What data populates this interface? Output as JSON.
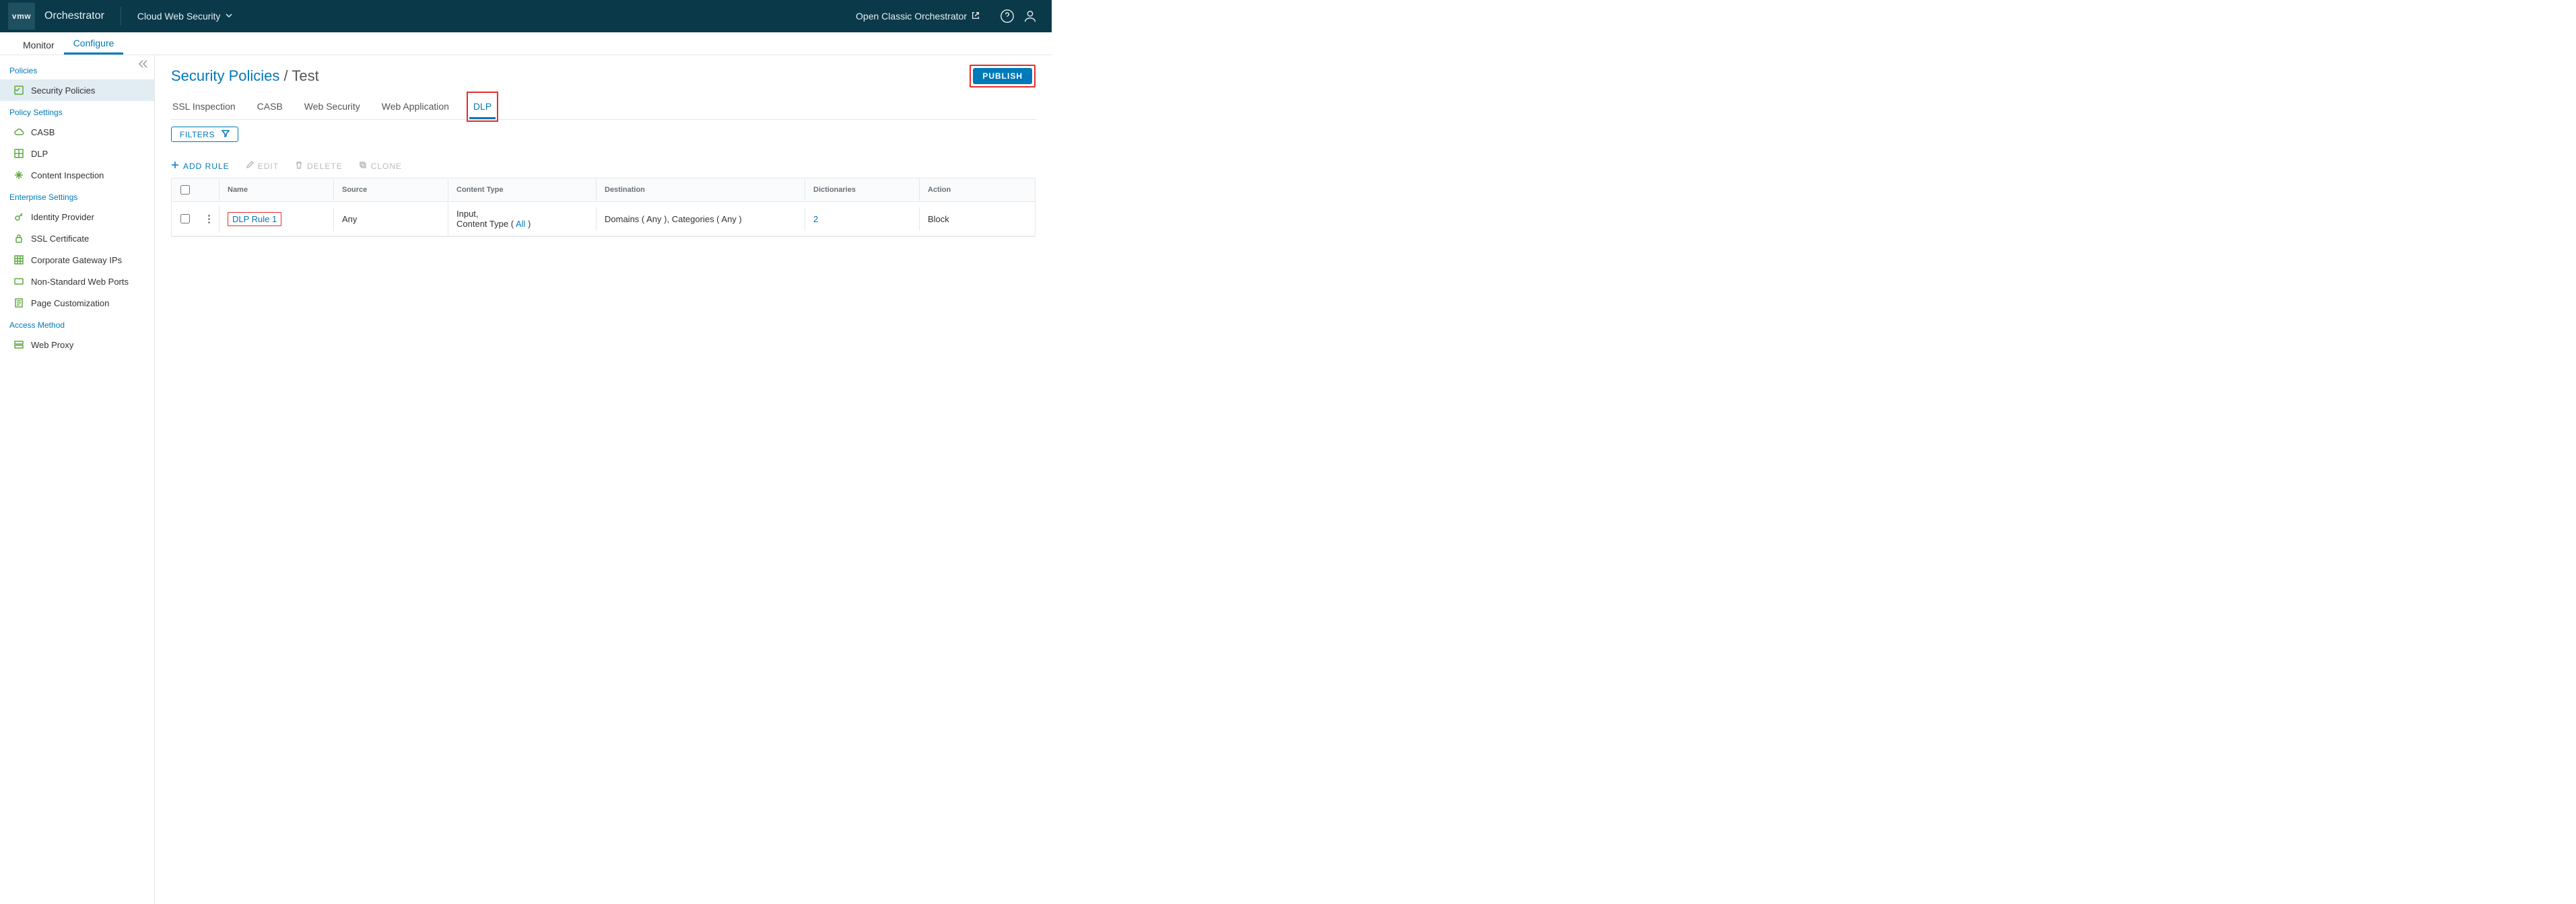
{
  "header": {
    "logo_text": "vmw",
    "product": "Orchestrator",
    "service": "Cloud Web Security",
    "classic_link": "Open Classic Orchestrator"
  },
  "nav_tabs": {
    "monitor": "Monitor",
    "configure": "Configure"
  },
  "sidebar": {
    "sections": {
      "policies_h": "Policies",
      "policy_settings_h": "Policy Settings",
      "enterprise_h": "Enterprise Settings",
      "access_h": "Access Method"
    },
    "items": {
      "security_policies": "Security Policies",
      "casb": "CASB",
      "dlp": "DLP",
      "content_inspection": "Content Inspection",
      "identity_provider": "Identity Provider",
      "ssl_certificate": "SSL Certificate",
      "corporate_gateway": "Corporate Gateway IPs",
      "nonstd_ports": "Non-Standard Web Ports",
      "page_custom": "Page Customization",
      "web_proxy": "Web Proxy"
    }
  },
  "breadcrumb": {
    "root": "Security Policies",
    "sep": " / ",
    "leaf": "Test"
  },
  "publish_label": "PUBLISH",
  "policy_tabs": {
    "ssl": "SSL Inspection",
    "casb": "CASB",
    "web_sec": "Web Security",
    "web_app": "Web Application",
    "dlp": "DLP"
  },
  "filters_label": "FILTERS",
  "toolbar": {
    "add": "ADD RULE",
    "edit": "EDIT",
    "del": "DELETE",
    "clone": "CLONE"
  },
  "table": {
    "headers": {
      "name": "Name",
      "source": "Source",
      "content_type": "Content Type",
      "destination": "Destination",
      "dictionaries": "Dictionaries",
      "action": "Action"
    },
    "rows": [
      {
        "name": "DLP Rule 1",
        "source": "Any",
        "content_type_line1": "Input,",
        "content_type_line2a": "Content Type ( ",
        "content_type_link": "All",
        "content_type_line2b": " )",
        "destination": "Domains ( Any ), Categories ( Any )",
        "dictionaries": "2",
        "action": "Block"
      }
    ]
  }
}
